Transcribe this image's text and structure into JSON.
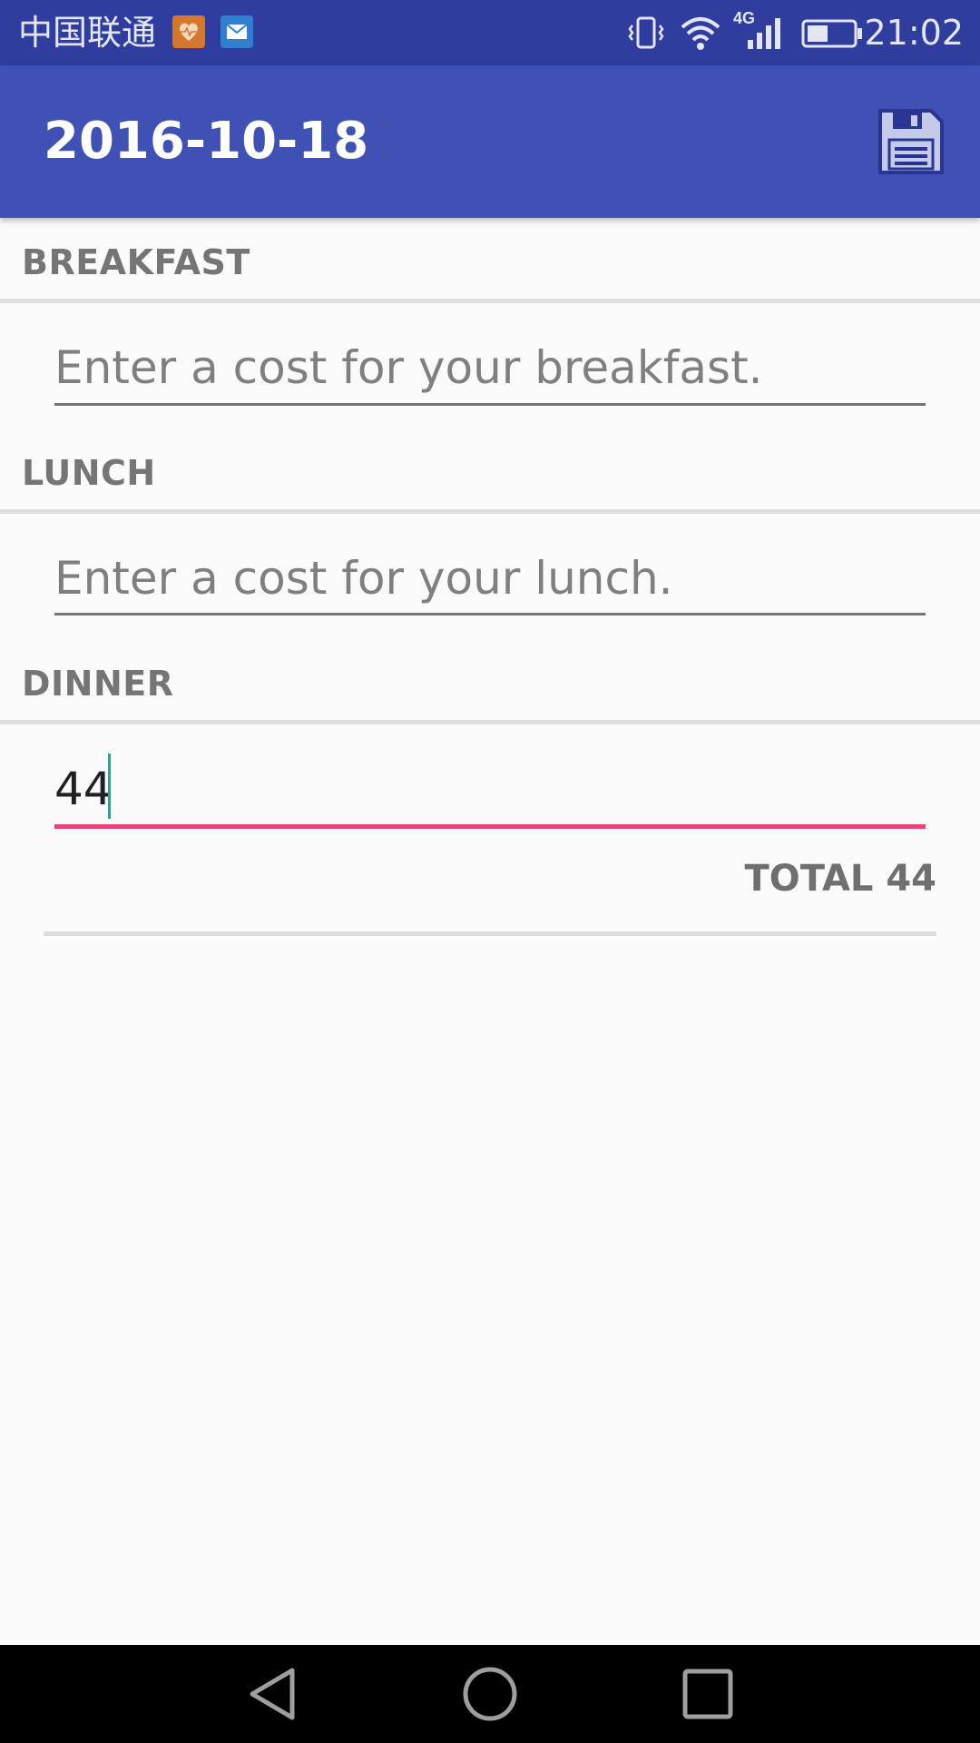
{
  "status_bar": {
    "carrier": "中国联通",
    "time": "21:02",
    "network": "4G",
    "icons": [
      "health-notification-icon",
      "mail-notification-icon",
      "vibrate-icon",
      "wifi-icon",
      "cell-signal-icon",
      "battery-icon"
    ]
  },
  "app_bar": {
    "title": "2016-10-18",
    "save_icon": "floppy-disk-icon",
    "color": "#3f51b5"
  },
  "sections": {
    "breakfast": {
      "label": "BREAKFAST",
      "value": "",
      "placeholder": "Enter a cost for your breakfast."
    },
    "lunch": {
      "label": "LUNCH",
      "value": "",
      "placeholder": "Enter a cost for your lunch."
    },
    "dinner": {
      "label": "DINNER",
      "value": "44",
      "placeholder": ""
    }
  },
  "total": {
    "text": "TOTAL 44"
  },
  "colors": {
    "accent": "#ec407a",
    "status_bar": "#2f3e9e",
    "label": "#757575"
  },
  "nav_bar": {
    "icons": [
      "back-icon",
      "home-icon",
      "recents-icon"
    ]
  }
}
